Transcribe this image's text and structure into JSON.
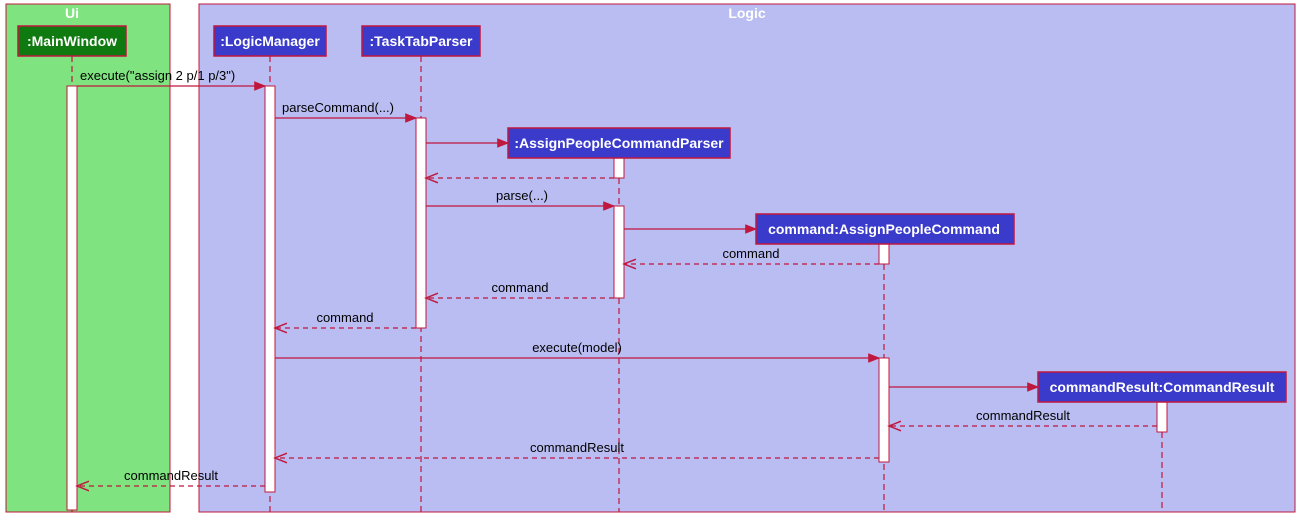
{
  "colors": {
    "ui_group_bg": "#7FE37F",
    "logic_group_bg": "#BABDF2",
    "ui_participant_bg": "#0F7A0F",
    "logic_participant_bg": "#3A3ACB",
    "stroke": "#C0173E"
  },
  "groups": {
    "ui": {
      "label": "Ui"
    },
    "logic": {
      "label": "Logic"
    }
  },
  "participants": {
    "mainWindow": ":MainWindow",
    "logicManager": ":LogicManager",
    "taskTabParser": ":TaskTabParser",
    "assignPeopleCommandParser": ":AssignPeopleCommandParser",
    "assignPeopleCommand": "command:AssignPeopleCommand",
    "commandResult": "commandResult:CommandResult"
  },
  "messages": {
    "m1": "execute(\"assign 2 p/1 p/3\")",
    "m2": "parseCommand(...)",
    "m3_return": "",
    "m4": "parse(...)",
    "m5_return": "command",
    "m6_return": "command",
    "m7_return": "command",
    "m8": "execute(model)",
    "m9_return": "",
    "m10_return": "commandResult",
    "m11_return": "commandResult",
    "m12_return": "commandResult"
  }
}
